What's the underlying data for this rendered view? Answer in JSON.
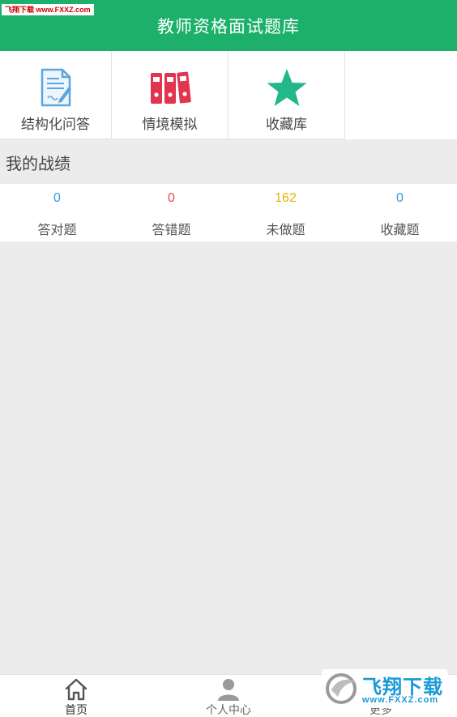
{
  "header": {
    "title": "教师资格面试题库"
  },
  "watermark": {
    "top_left": "飞翔下载 www.FXXZ.com",
    "bottom_right_text": "飞翔下载",
    "bottom_right_url": "www.FXXZ.com"
  },
  "menu": [
    {
      "label": "结构化问答",
      "icon": "document-edit-icon",
      "color": "#5aa6e0"
    },
    {
      "label": "情境模拟",
      "icon": "binders-icon",
      "color": "#e0344f"
    },
    {
      "label": "收藏库",
      "icon": "star-icon",
      "color": "#22b889"
    }
  ],
  "section": {
    "title": "我的战绩"
  },
  "stats": [
    {
      "value": "0",
      "label": "答对题",
      "color": "#3b9ad9"
    },
    {
      "value": "0",
      "label": "答错题",
      "color": "#e24b4b"
    },
    {
      "value": "162",
      "label": "未做题",
      "color": "#e2b400"
    },
    {
      "value": "0",
      "label": "收藏题",
      "color": "#3b9ad9"
    }
  ],
  "tabs": [
    {
      "label": "首页",
      "icon": "home-icon",
      "active": true
    },
    {
      "label": "个人中心",
      "icon": "user-icon",
      "active": false
    },
    {
      "label": "更多",
      "icon": "more-icon",
      "active": false
    }
  ],
  "colors": {
    "brand": "#1db06b",
    "background": "#ececec"
  }
}
